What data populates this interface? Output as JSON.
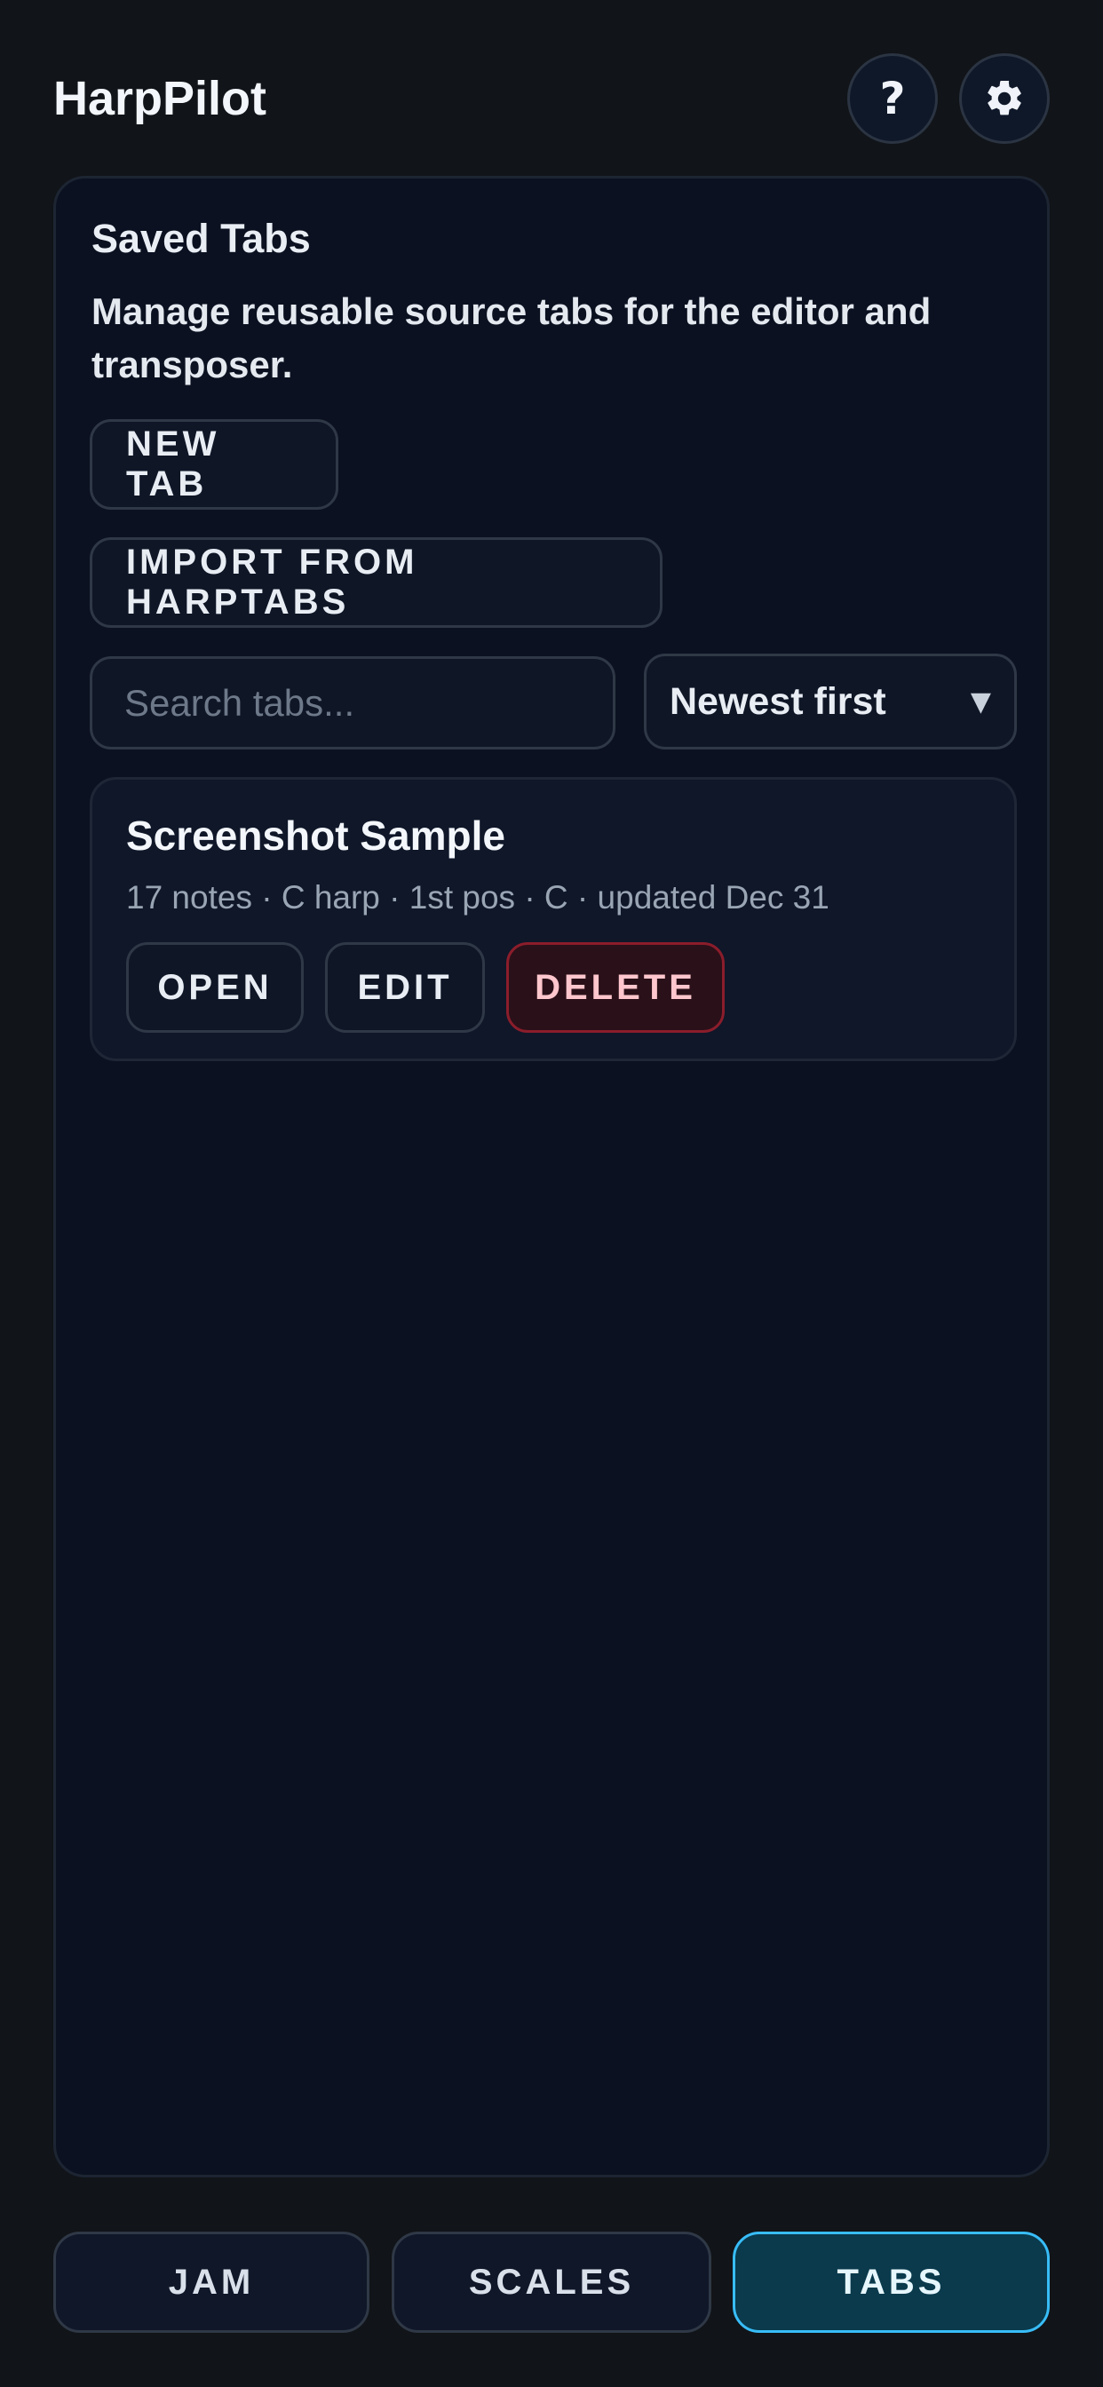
{
  "app": {
    "title": "HarpPilot"
  },
  "header": {
    "help_icon": "question-mark-icon",
    "help_label": "?",
    "settings_icon": "gear-icon"
  },
  "panel": {
    "title": "Saved Tabs",
    "description": "Manage reusable source tabs for the editor and transposer.",
    "new_tab_label": "NEW TAB",
    "import_label": "IMPORT FROM HARPTABS",
    "search": {
      "placeholder": "Search tabs...",
      "value": ""
    },
    "sort": {
      "selected": "Newest first",
      "caret_icon": "triangle-down-icon"
    },
    "tabs": [
      {
        "title": "Screenshot Sample",
        "meta": "17 notes · C harp · 1st pos · C · updated Dec 31",
        "open_label": "OPEN",
        "edit_label": "EDIT",
        "delete_label": "DELETE"
      }
    ]
  },
  "bottom_nav": {
    "items": [
      {
        "label": "JAM",
        "active": false
      },
      {
        "label": "SCALES",
        "active": false
      },
      {
        "label": "TABS",
        "active": true
      }
    ]
  },
  "colors": {
    "background": "#111418",
    "panel": "#0b1120",
    "accent": "#38bdf8",
    "active_tab_bg": "#0a3a4c",
    "danger_border": "#8b1d2b",
    "danger_text": "#ffc7cd"
  }
}
